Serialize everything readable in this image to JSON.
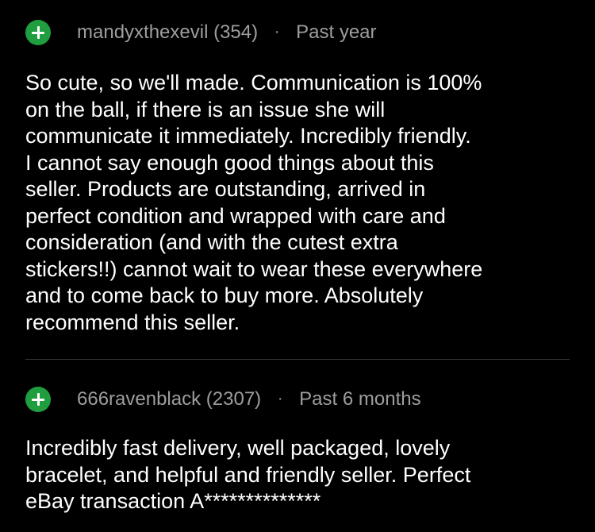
{
  "colors": {
    "background": "#000000",
    "text": "#ffffff",
    "meta": "#9e9e9e",
    "positive_badge": "#1f9d3f",
    "divider": "#3a3a3a"
  },
  "reviews": [
    {
      "icon": "positive-plus-icon",
      "username": "mandyxthexevil",
      "score": "(354)",
      "separator": "·",
      "time": "Past year",
      "lines": [
        "So cute, so we'll made. Communication is 100%",
        "on the ball, if there is an issue she will",
        "communicate it immediately. Incredibly friendly.",
        "I cannot say enough good things about this",
        "seller. Products are outstanding, arrived in",
        "perfect condition and wrapped with care and",
        "consideration (and with the cutest extra",
        "stickers!!) cannot wait to wear these everywhere",
        "and to come back to buy more. Absolutely",
        "recommend this seller."
      ]
    },
    {
      "icon": "positive-plus-icon",
      "username": "666ravenblack",
      "score": "(2307)",
      "separator": "·",
      "time": "Past 6 months",
      "lines": [
        "Incredibly fast delivery, well packaged, lovely",
        "bracelet, and helpful and friendly seller. Perfect",
        "eBay transaction A**************"
      ]
    }
  ]
}
